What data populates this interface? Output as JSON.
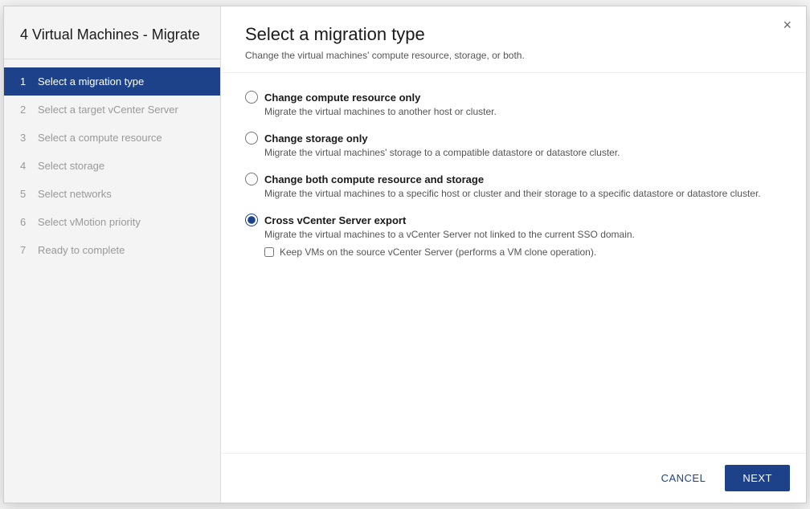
{
  "dialog": {
    "close_label": "×"
  },
  "sidebar": {
    "title": "4 Virtual Machines - Migrate",
    "steps": [
      {
        "num": "1",
        "label": "Select a migration type",
        "active": true
      },
      {
        "num": "2",
        "label": "Select a target vCenter Server",
        "active": false
      },
      {
        "num": "3",
        "label": "Select a compute resource",
        "active": false
      },
      {
        "num": "4",
        "label": "Select storage",
        "active": false
      },
      {
        "num": "5",
        "label": "Select networks",
        "active": false
      },
      {
        "num": "6",
        "label": "Select vMotion priority",
        "active": false
      },
      {
        "num": "7",
        "label": "Ready to complete",
        "active": false
      }
    ]
  },
  "main": {
    "title": "Select a migration type",
    "subtitle": "Change the virtual machines' compute resource, storage, or both.",
    "options": [
      {
        "id": "opt1",
        "label": "Change compute resource only",
        "desc": "Migrate the virtual machines to another host or cluster.",
        "selected": false
      },
      {
        "id": "opt2",
        "label": "Change storage only",
        "desc": "Migrate the virtual machines' storage to a compatible datastore or datastore cluster.",
        "selected": false
      },
      {
        "id": "opt3",
        "label": "Change both compute resource and storage",
        "desc": "Migrate the virtual machines to a specific host or cluster and their storage to a specific datastore or datastore cluster.",
        "selected": false
      },
      {
        "id": "opt4",
        "label": "Cross vCenter Server export",
        "desc": "Migrate the virtual machines to a vCenter Server not linked to the current SSO domain.",
        "selected": true,
        "checkbox_label": "Keep VMs on the source vCenter Server (performs a VM clone operation)."
      }
    ]
  },
  "footer": {
    "cancel_label": "CANCEL",
    "next_label": "NEXT"
  }
}
